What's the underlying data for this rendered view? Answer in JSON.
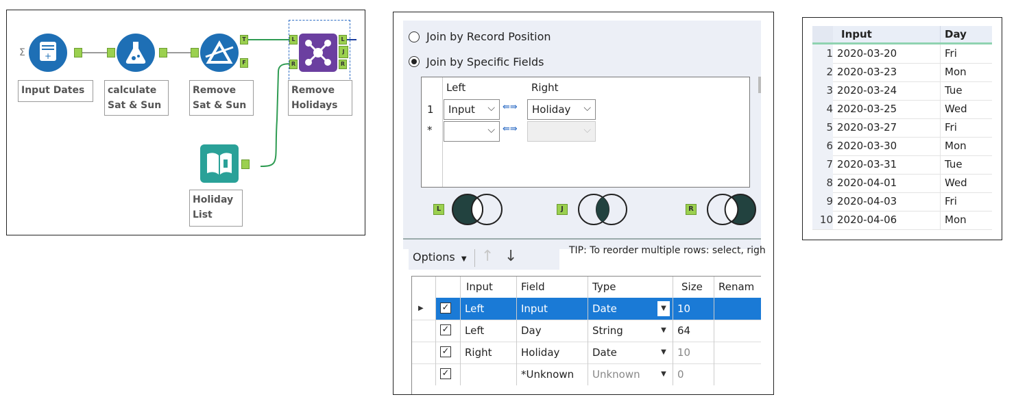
{
  "workflow": {
    "tools": [
      {
        "label": "Input Dates"
      },
      {
        "label": "calculate\nSat & Sun"
      },
      {
        "label": "Remove\nSat & Sun"
      },
      {
        "label": "Remove\nHolidays"
      },
      {
        "label": "Holiday\nList"
      }
    ],
    "anchors": {
      "true": "T",
      "false": "F",
      "left": "L",
      "right": "R",
      "join": "J"
    }
  },
  "join_config": {
    "radio_position": "Join by Record Position",
    "radio_fields": "Join by Specific Fields",
    "grid_header_left": "Left",
    "grid_header_right": "Right",
    "row1_num": "1",
    "row1_left": "Input",
    "row1_right": "Holiday",
    "row2_num": "*",
    "venn_labels": {
      "left": "L",
      "join": "J",
      "right": "R"
    },
    "options_label": "Options",
    "tip": "TIP: To reorder multiple rows: select, righ",
    "table": {
      "headers": [
        "Input",
        "Field",
        "Type",
        "Size",
        "Renam"
      ],
      "rows": [
        {
          "input": "Left",
          "field": "Input",
          "type": "Date",
          "size": "10",
          "selected": true
        },
        {
          "input": "Left",
          "field": "Day",
          "type": "String",
          "size": "64",
          "selected": false
        },
        {
          "input": "Right",
          "field": "Holiday",
          "type": "Date",
          "size": "10",
          "selected": false
        },
        {
          "input": "",
          "field": "*Unknown",
          "type": "Unknown",
          "size": "0",
          "selected": false
        }
      ]
    }
  },
  "output": {
    "headers": {
      "input": "Input",
      "day": "Day"
    },
    "rows": [
      {
        "n": "1",
        "input": "2020-03-20",
        "day": "Fri"
      },
      {
        "n": "2",
        "input": "2020-03-23",
        "day": "Mon"
      },
      {
        "n": "3",
        "input": "2020-03-24",
        "day": "Tue"
      },
      {
        "n": "4",
        "input": "2020-03-25",
        "day": "Wed"
      },
      {
        "n": "5",
        "input": "2020-03-27",
        "day": "Fri"
      },
      {
        "n": "6",
        "input": "2020-03-30",
        "day": "Mon"
      },
      {
        "n": "7",
        "input": "2020-03-31",
        "day": "Tue"
      },
      {
        "n": "8",
        "input": "2020-04-01",
        "day": "Wed"
      },
      {
        "n": "9",
        "input": "2020-04-03",
        "day": "Fri"
      },
      {
        "n": "10",
        "input": "2020-04-06",
        "day": "Mon"
      }
    ]
  },
  "colors": {
    "tool_blue": "#1e6fb5",
    "join_purple": "#6b3fa0",
    "holiday_teal": "#2aa198",
    "selection": "#1a7ad6"
  }
}
